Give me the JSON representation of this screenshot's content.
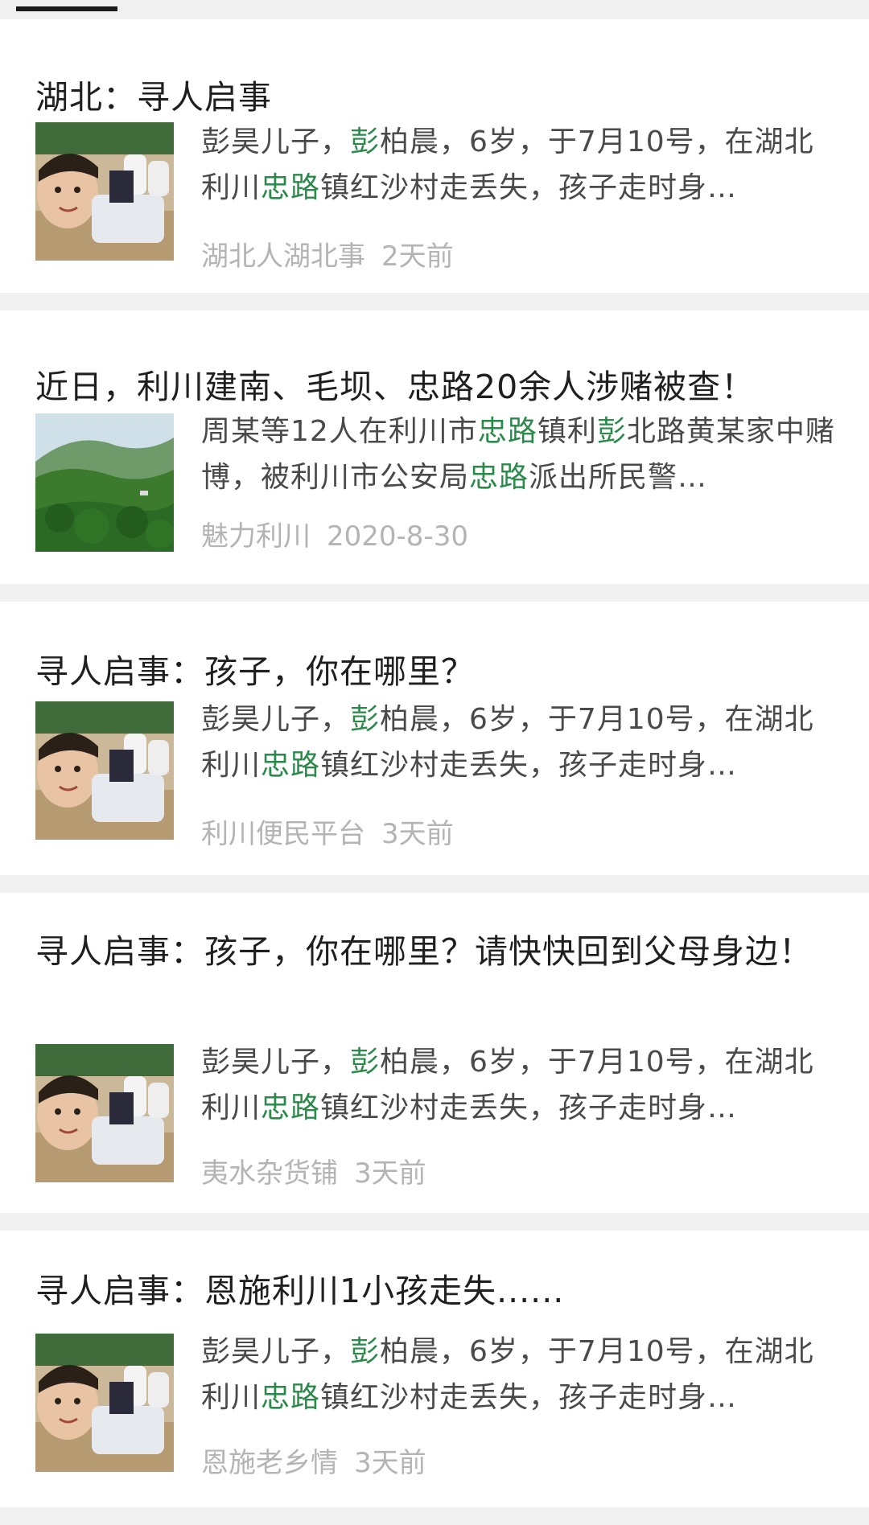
{
  "results": [
    {
      "title": "湖北：寻人启事",
      "desc_parts": [
        {
          "text": "彭昊儿子，",
          "hl": false
        },
        {
          "text": "彭",
          "hl": true
        },
        {
          "text": "柏晨，6岁，于7月10号，在湖北利川",
          "hl": false
        },
        {
          "text": "忠路",
          "hl": true
        },
        {
          "text": "镇红沙村走丢失，孩子走时身…",
          "hl": false
        }
      ],
      "source": "湖北人湖北事",
      "time": "2天前",
      "thumb": "boy-photo"
    },
    {
      "title_parts": [
        {
          "text": "近日，利川建南、毛坝、",
          "hl": false
        },
        {
          "text": "忠路",
          "hl": true
        },
        {
          "text": "20余人涉赌被查！",
          "hl": false
        }
      ],
      "desc_parts": [
        {
          "text": "周某等12人在利川市",
          "hl": false
        },
        {
          "text": "忠路",
          "hl": true
        },
        {
          "text": "镇利",
          "hl": false
        },
        {
          "text": "彭",
          "hl": true
        },
        {
          "text": "北路黄某家中赌博，被利川市公安局",
          "hl": false
        },
        {
          "text": "忠路",
          "hl": true
        },
        {
          "text": "派出所民警…",
          "hl": false
        }
      ],
      "source": "魅力利川",
      "time": "2020-8-30",
      "thumb": "mountain-photo"
    },
    {
      "title": "寻人启事：孩子，你在哪里？",
      "desc_parts": [
        {
          "text": "彭昊儿子，",
          "hl": false
        },
        {
          "text": "彭",
          "hl": true
        },
        {
          "text": "柏晨，6岁，于7月10号，在湖北利川",
          "hl": false
        },
        {
          "text": "忠路",
          "hl": true
        },
        {
          "text": "镇红沙村走丢失，孩子走时身…",
          "hl": false
        }
      ],
      "source": "利川便民平台",
      "time": "3天前",
      "thumb": "boy-photo"
    },
    {
      "title": "寻人启事：孩子，你在哪里？请快快回到父母身边！",
      "desc_parts": [
        {
          "text": "彭昊儿子，",
          "hl": false
        },
        {
          "text": "彭",
          "hl": true
        },
        {
          "text": "柏晨，6岁，于7月10号，在湖北利川",
          "hl": false
        },
        {
          "text": "忠路",
          "hl": true
        },
        {
          "text": "镇红沙村走丢失，孩子走时身…",
          "hl": false
        }
      ],
      "source": "夷水杂货铺",
      "time": "3天前",
      "thumb": "boy-photo"
    },
    {
      "title": "寻人启事：恩施利川1小孩走失......",
      "desc_parts": [
        {
          "text": "彭昊儿子，",
          "hl": false
        },
        {
          "text": "彭",
          "hl": true
        },
        {
          "text": "柏晨，6岁，于7月10号，在湖北利川",
          "hl": false
        },
        {
          "text": "忠路",
          "hl": true
        },
        {
          "text": "镇红沙村走丢失，孩子走时身…",
          "hl": false
        }
      ],
      "source": "恩施老乡情",
      "time": "3天前",
      "thumb": "boy-photo"
    }
  ],
  "colors": {
    "highlight": "#2a8a4a",
    "title": "#1f1f1f",
    "desc": "#4a4a4a",
    "meta": "#b4b4b4",
    "background": "#f0f0f0"
  }
}
